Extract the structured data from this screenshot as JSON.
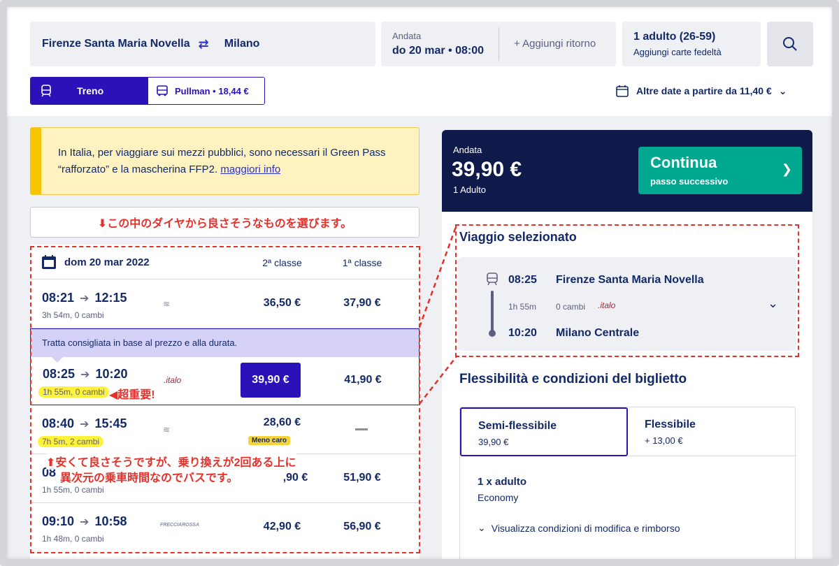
{
  "search": {
    "from": "Firenze Santa Maria Novella",
    "to": "Milano",
    "date_label": "Andata",
    "date_value": "do 20 mar • 08:00",
    "add_return": "+ Aggiungi ritorno",
    "pax_title": "1 adulto (26-59)",
    "pax_sub": "Aggiungi carte fedeltà"
  },
  "modes": {
    "train": "Treno",
    "bus": "Pullman • 18,44 €"
  },
  "other_dates": "Altre date a partire da 11,40 €",
  "notice": {
    "text": "In Italia, per viaggiare sui mezzi pubblici, sono necessari il Green Pass “rafforzato” e la mascherina FFP2.",
    "link": "maggiori info"
  },
  "annotations": {
    "top": "⬇この中のダイヤから良さそうなものを選びます。",
    "important": "◀超重要!",
    "cheap_line1": "⬆安くて良さそうですが、乗り換えが2回ある上に",
    "cheap_line2": "異次元の乗車時間なのでバスです。"
  },
  "results": {
    "date": "dom 20 mar 2022",
    "col_2nd": "2ª classe",
    "col_1st": "1ª classe",
    "recommended_banner": "Tratta consigliata in base al prezzo e alla durata.",
    "rows": [
      {
        "dep": "08:21",
        "arr": "12:15",
        "meta": "3h 54m, 0 cambi",
        "logo": "≋",
        "p2": "36,50 €",
        "p1": "37,90 €"
      },
      {
        "dep": "08:25",
        "arr": "10:20",
        "meta": "1h 55m, 0 cambi",
        "logo": ".italo",
        "p2": "39,90 €",
        "p1": "41,90 €"
      },
      {
        "dep": "08:40",
        "arr": "15:45",
        "meta": "7h 5m, 2 cambi",
        "logo": "≋",
        "p2": "28,60 €",
        "badge": "Meno caro",
        "p1": ""
      },
      {
        "dep": "08",
        "arr": "",
        "meta": "1h 55m, 0 cambi",
        "logo": "",
        "p2": ",90 €",
        "p1": "51,90 €"
      },
      {
        "dep": "09:10",
        "arr": "10:58",
        "meta": "1h 48m, 0 cambi",
        "logo": "FRECCIAROSSA",
        "p2": "42,90 €",
        "p1": "56,90 €"
      }
    ]
  },
  "summary": {
    "label": "Andata",
    "price": "39,90 €",
    "pax": "1 Adulto",
    "continue": "Continua",
    "continue_sub": "passo successivo"
  },
  "selected_trip": {
    "title": "Viaggio selezionato",
    "dep_time": "08:25",
    "dep_station": "Firenze Santa Maria Novella",
    "duration": "1h 55m",
    "changes": "0 cambi",
    "operator": ".italo",
    "arr_time": "10:20",
    "arr_station": "Milano Centrale"
  },
  "fare": {
    "title": "Flessibilità e condizioni del biglietto",
    "semi_name": "Semi-flessibile",
    "semi_price": "39,90 €",
    "full_name": "Flessibile",
    "full_price": "+ 13,00 €",
    "adult": "1 x adulto",
    "class": "Economy",
    "conditions": "Visualizza condizioni di modifica e rimborso"
  },
  "colors": {
    "brand": "#2a12b8",
    "navy": "#0f1a4a",
    "teal": "#00a88f",
    "annotation_red": "#e8302a",
    "highlight_yellow": "#fff23a"
  }
}
